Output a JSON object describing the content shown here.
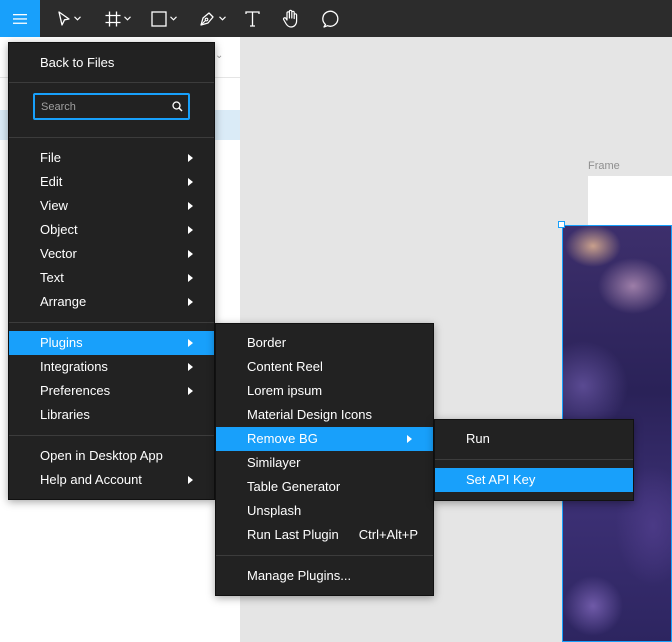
{
  "toolbar": {
    "tools": [
      {
        "name": "menu-icon"
      },
      {
        "name": "move-tool-icon"
      },
      {
        "name": "frame-tool-icon"
      },
      {
        "name": "rectangle-tool-icon"
      },
      {
        "name": "pen-tool-icon"
      },
      {
        "name": "text-tool-icon"
      },
      {
        "name": "hand-tool-icon"
      },
      {
        "name": "comment-tool-icon"
      }
    ]
  },
  "canvas": {
    "frame_label": "Frame"
  },
  "main_menu": {
    "back": "Back to Files",
    "search_placeholder": "Search",
    "items": [
      {
        "label": "File",
        "submenu": true
      },
      {
        "label": "Edit",
        "submenu": true
      },
      {
        "label": "View",
        "submenu": true
      },
      {
        "label": "Object",
        "submenu": true
      },
      {
        "label": "Vector",
        "submenu": true
      },
      {
        "label": "Text",
        "submenu": true
      },
      {
        "label": "Arrange",
        "submenu": true
      },
      {
        "label": "Plugins",
        "submenu": true,
        "highlighted": true
      },
      {
        "label": "Integrations",
        "submenu": true
      },
      {
        "label": "Preferences",
        "submenu": true
      },
      {
        "label": "Libraries",
        "submenu": false
      },
      {
        "label": "Open in Desktop App",
        "submenu": false
      },
      {
        "label": "Help and Account",
        "submenu": true
      }
    ]
  },
  "plugins_menu": {
    "items": [
      {
        "label": "Border"
      },
      {
        "label": "Content Reel"
      },
      {
        "label": "Lorem ipsum"
      },
      {
        "label": "Material Design Icons"
      },
      {
        "label": "Remove BG",
        "submenu": true,
        "highlighted": true
      },
      {
        "label": "Similayer"
      },
      {
        "label": "Table Generator"
      },
      {
        "label": "Unsplash"
      },
      {
        "label": "Run Last Plugin",
        "shortcut": "Ctrl+Alt+P"
      },
      {
        "label": "Manage Plugins..."
      }
    ]
  },
  "removebg_menu": {
    "items": [
      {
        "label": "Run"
      },
      {
        "label": "Set API Key",
        "highlighted": true
      }
    ]
  },
  "colors": {
    "accent": "#18a0fb",
    "menu_bg": "#222222",
    "toolbar_bg": "#2c2c2c"
  }
}
